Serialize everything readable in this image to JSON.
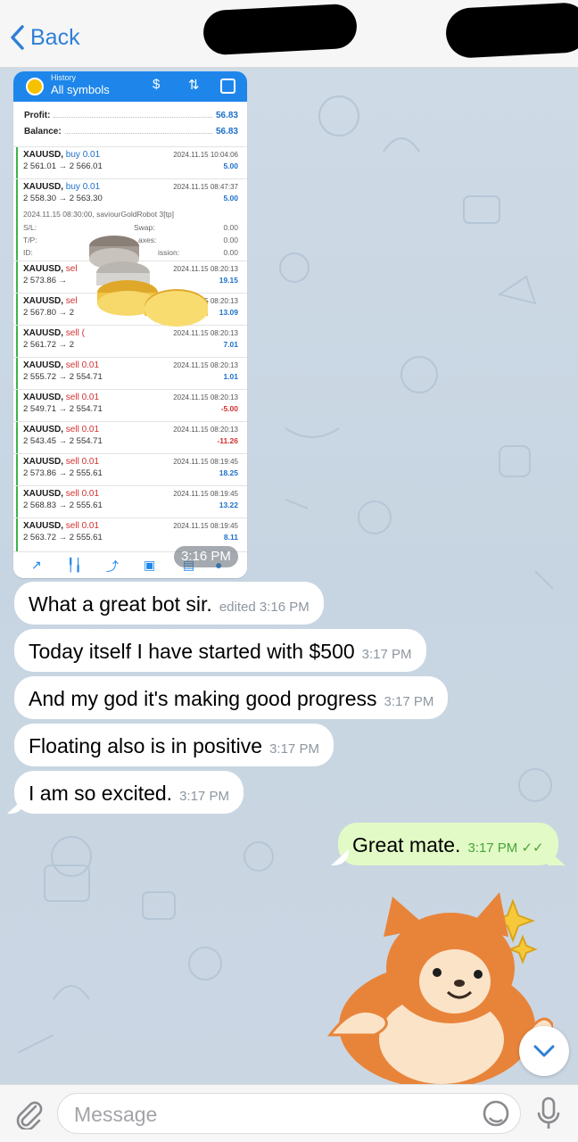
{
  "header": {
    "back_label": "Back"
  },
  "screenshot": {
    "app_header_small": "History",
    "app_header_title": "All symbols",
    "profit_label": "Profit:",
    "profit_value": "56.83",
    "balance_label": "Balance:",
    "balance_value": "56.83",
    "trades": [
      {
        "symbol": "XAUUSD,",
        "action": "buy 0.01",
        "prices": "2 561.01 → 2 566.01",
        "datetime": "2024.11.15 10:04:06",
        "pl": "5.00"
      },
      {
        "symbol": "XAUUSD,",
        "action": "buy 0.01",
        "prices": "2 558.30 → 2 563.30",
        "datetime": "2024.11.15 08:47:37",
        "pl": "5.00"
      },
      {
        "symbol": "XAUUSD,",
        "action": "sel",
        "prices": "2 573.86 →",
        "datetime": "2024.11.15 08:20:13",
        "pl": "19.15"
      },
      {
        "symbol": "XAUUSD,",
        "action": "sel",
        "prices": "2 567.80 → 2",
        "datetime": "5 08:20:13",
        "pl": "13.09"
      },
      {
        "symbol": "XAUUSD,",
        "action": "sell (",
        "prices": "2 561.72 → 2",
        "datetime": "2024.11.15 08:20:13",
        "pl": "7.01"
      },
      {
        "symbol": "XAUUSD,",
        "action": "sell 0.01",
        "prices": "2 555.72 → 2 554.71",
        "datetime": "2024.11.15 08:20:13",
        "pl": "1.01"
      },
      {
        "symbol": "XAUUSD,",
        "action": "sell 0.01",
        "prices": "2 549.71 → 2 554.71",
        "datetime": "2024.11.15 08:20:13",
        "pl": "-5.00"
      },
      {
        "symbol": "XAUUSD,",
        "action": "sell 0.01",
        "prices": "2 543.45 → 2 554.71",
        "datetime": "2024.11.15 08:20:13",
        "pl": "-11.26"
      },
      {
        "symbol": "XAUUSD,",
        "action": "sell 0.01",
        "prices": "2 573.86 → 2 555.61",
        "datetime": "2024.11.15 08:19:45",
        "pl": "18.25"
      },
      {
        "symbol": "XAUUSD,",
        "action": "sell 0.01",
        "prices": "2 568.83 → 2 555.61",
        "datetime": "2024.11.15 08:19:45",
        "pl": "13.22"
      },
      {
        "symbol": "XAUUSD,",
        "action": "sell 0.01",
        "prices": "2 563.72 → 2 555.61",
        "datetime": "2024.11.15 08:19:45",
        "pl": "8.11"
      }
    ],
    "detail_line": "2024.11.15 08:30:00, saviourGoldRobot 3[tp]",
    "sl_label": "S/L:",
    "tp_label": "T/P:",
    "id_label": "ID:",
    "swap_label": "Swap:",
    "taxes_label": "axes:",
    "commission_label": "ission:",
    "swap_value": "0.00",
    "taxes_value": "0.00",
    "commission_value": "0.00",
    "timestamp": "3:16 PM"
  },
  "messages": [
    {
      "text": "What a great bot sir.",
      "meta": "edited 3:16 PM"
    },
    {
      "text": "Today itself I have started with $500",
      "meta": "3:17 PM"
    },
    {
      "text": "And my god it's making good progress",
      "meta": "3:17 PM"
    },
    {
      "text": "Floating also is in positive",
      "meta": "3:17 PM"
    },
    {
      "text": "I am so excited.",
      "meta": "3:17 PM"
    }
  ],
  "outgoing": {
    "text": "Great mate.",
    "meta": "3:17 PM",
    "status": "✓✓"
  },
  "composer": {
    "placeholder": "Message"
  },
  "colors": {
    "accent": "#2f7fd6",
    "outgoing_bubble": "#e2fbc6",
    "chart_header": "#1e86ea"
  }
}
